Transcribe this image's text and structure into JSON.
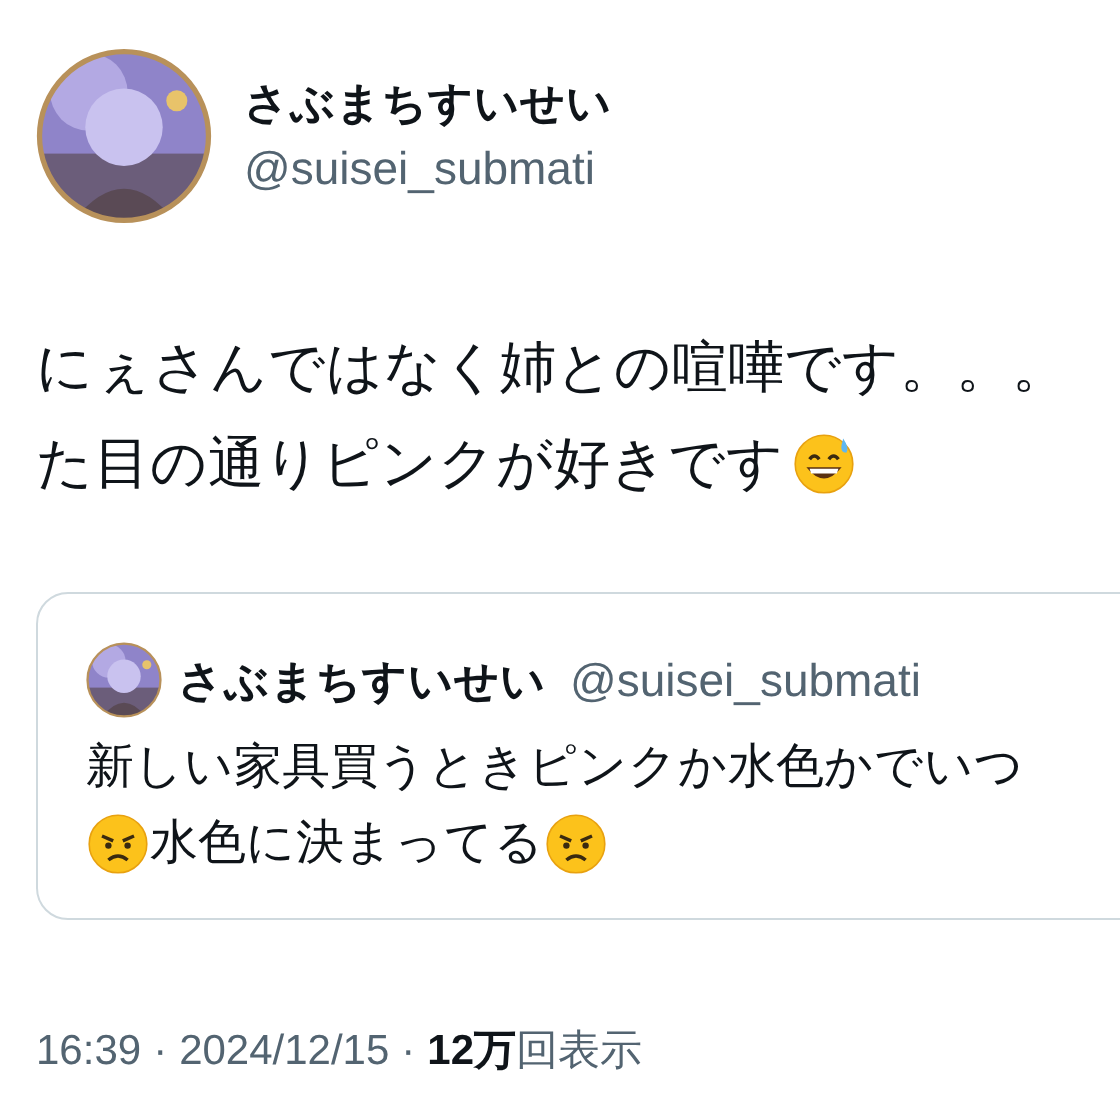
{
  "author": {
    "name": "さぶまちすいせい",
    "handle": "@suisei_submati"
  },
  "text_lines": [
    "にぇさんではなく姉との喧嘩です。。。",
    "た目の通りピンクが好きです"
  ],
  "quote": {
    "name": "さぶまちすいせい",
    "handle": "@suisei_submati",
    "text_lines": [
      "新しい家具買うときピンクか水色かでいつ",
      "水色に決まってる"
    ]
  },
  "meta": {
    "time": "16:39",
    "separator_1": "·",
    "date": "2024/12/15",
    "separator_2": "·",
    "views_count": "12万",
    "views_label": "回表示"
  }
}
